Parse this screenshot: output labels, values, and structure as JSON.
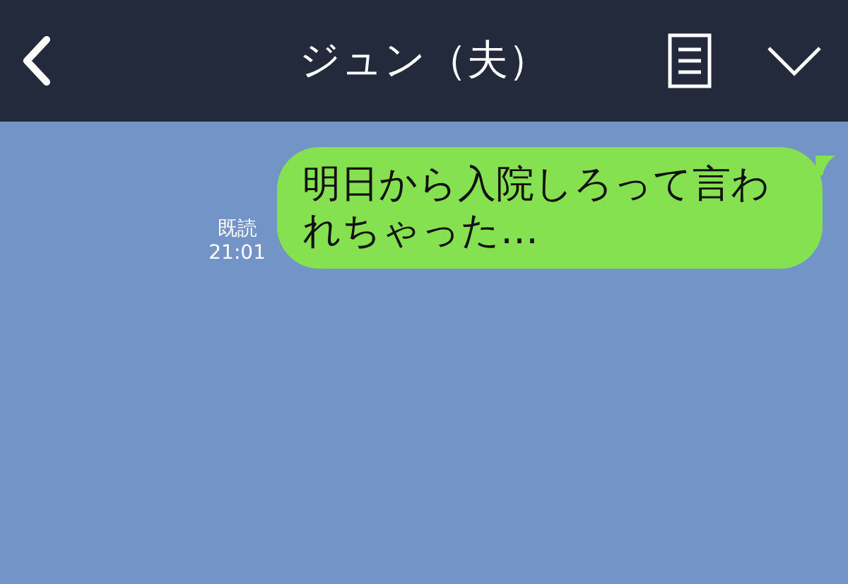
{
  "header": {
    "title": "ジュン（夫）"
  },
  "messages": [
    {
      "text": "明日から入院しろって言われちゃった…",
      "read_label": "既読",
      "time": "21:01"
    }
  ]
}
